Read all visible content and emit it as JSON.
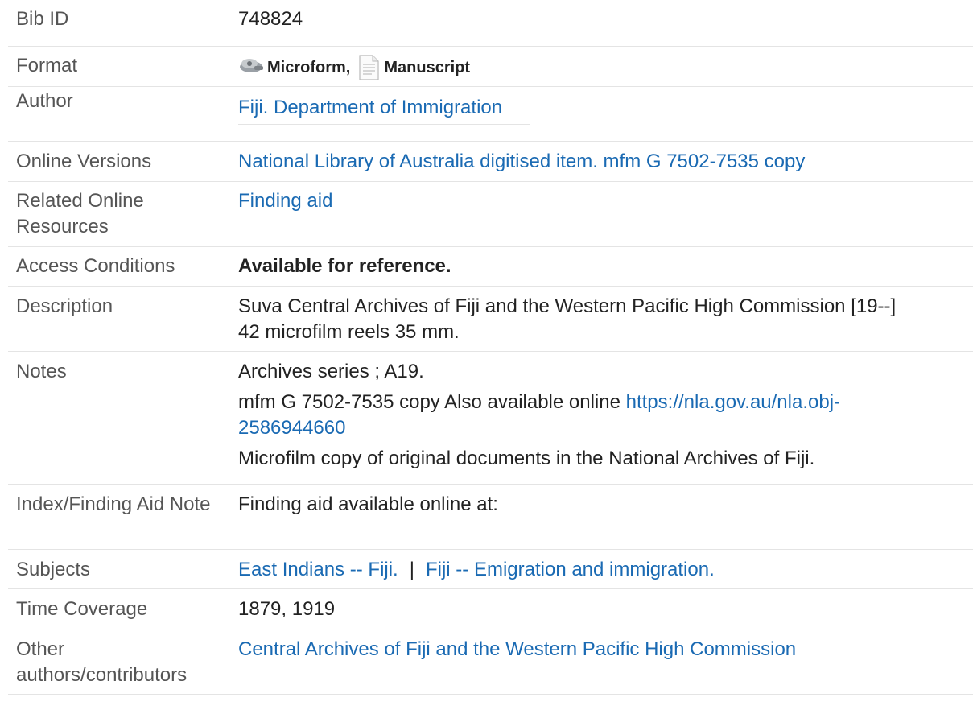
{
  "record": {
    "bib_id": {
      "label": "Bib ID",
      "value": "748824"
    },
    "format": {
      "label": "Format",
      "items": [
        {
          "name": "Microform",
          "suffix": ",",
          "icon": "microform-icon"
        },
        {
          "name": "Manuscript",
          "suffix": "",
          "icon": "manuscript-icon"
        }
      ]
    },
    "author": {
      "label": "Author",
      "value": "Fiji. Department of Immigration"
    },
    "online_versions": {
      "label": "Online Versions",
      "value": "National Library of Australia digitised item. mfm G 7502-7535 copy"
    },
    "related": {
      "label": "Related Online Resources",
      "value": "Finding aid"
    },
    "access": {
      "label": "Access Conditions",
      "value": "Available for reference."
    },
    "description": {
      "label": "Description",
      "line1": "Suva Central Archives of Fiji and the Western Pacific High Commission [19--]",
      "line2": "42 microfilm reels 35 mm."
    },
    "notes": {
      "label": "Notes",
      "note1": "Archives series ; A19.",
      "note2_text": "mfm G 7502-7535 copy Also available online ",
      "note2_link_a": "https://nla.gov.au/nla.obj-",
      "note2_link_b": "2586944660",
      "note3": "Microfilm copy of original documents in the National Archives of Fiji."
    },
    "index_note": {
      "label": "Index/Finding Aid Note",
      "value": "Finding aid available online at:"
    },
    "subjects": {
      "label": "Subjects",
      "items": [
        "East Indians -- Fiji.",
        "Fiji -- Emigration and immigration."
      ],
      "separator": "|"
    },
    "time_coverage": {
      "label": "Time Coverage",
      "value": "1879, 1919"
    },
    "other_authors": {
      "label": "Other authors/contributors",
      "value": "Central Archives of Fiji and the Western Pacific High Commission"
    }
  },
  "colors": {
    "link": "#1a6ab3",
    "label": "#555555",
    "text": "#222222",
    "divider": "#e4e4e4"
  }
}
